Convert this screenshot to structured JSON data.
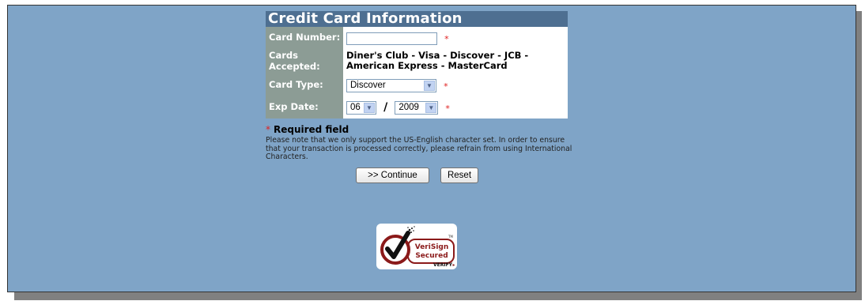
{
  "form": {
    "title": "Credit Card Information",
    "card_number_label": "Card Number:",
    "card_number_value": "",
    "cards_accepted_label": "Cards Accepted:",
    "cards_accepted_line1": "Diner's Club - Visa - Discover - JCB -",
    "cards_accepted_line2": "American Express - MasterCard",
    "card_type_label": "Card Type:",
    "card_type_value": "Discover",
    "exp_date_label": "Exp Date:",
    "exp_month": "06",
    "exp_separator": "/",
    "exp_year": "2009",
    "required_marker": "*"
  },
  "notes": {
    "required_field": "Required field",
    "notice": "Please note that we only support the US-English character set. In order to ensure that your transaction is processed correctly, please refrain from using International Characters."
  },
  "buttons": {
    "continue_label": ">> Continue",
    "reset_label": "Reset"
  },
  "seal": {
    "brand": "VeriSign",
    "text": "Secured",
    "verify": "VERIFY",
    "verify_arrow": "▸",
    "tm": "TM"
  },
  "colors": {
    "panel_bg": "#7fa4c7",
    "title_bar": "#4e6f91",
    "label_bg": "#8c9c95",
    "required": "#e02020",
    "seal_red": "#8b1a1a"
  },
  "icons": {
    "dropdown": "chevron-down-icon",
    "seal_check": "checkmark-icon"
  }
}
